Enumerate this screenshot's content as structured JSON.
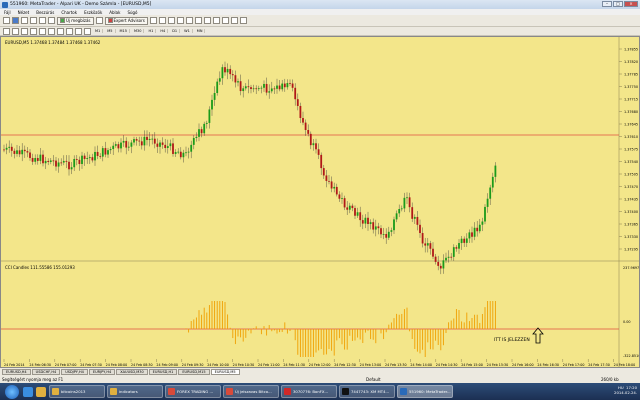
{
  "window": {
    "title": "551960: MetaTrader - Alpari UK - Demo Számla - [EURUSD,M5]"
  },
  "menu": [
    "Fájl",
    "Nézet",
    "Beszúrás",
    "Chartok",
    "Eszközök",
    "Ablak",
    "Súgó"
  ],
  "toolbar": {
    "new_order": "Új megbízás",
    "expert_advisors": "Expert Advisors",
    "timeframes": [
      "M1",
      "M5",
      "M15",
      "M30",
      "H1",
      "H4",
      "D1",
      "W1",
      "MN"
    ]
  },
  "chart": {
    "header": "EURUSD,M5  1.37468 1.37484 1.37468 1.37462",
    "indicator_header": "CCI Candles 111.55586 155.01293",
    "annotation": "ITT IS JELEZZEN",
    "price_labels": [
      "1.37855",
      "1.37820",
      "1.37785",
      "1.37750",
      "1.37715",
      "1.37680",
      "1.37645",
      "1.37610",
      "1.37575",
      "1.37540",
      "1.37505",
      "1.37470",
      "1.37435",
      "1.37400",
      "1.37365",
      "1.37330",
      "1.37295"
    ],
    "cci_labels": [
      "237.9697",
      "0.00",
      "-322.8510"
    ],
    "time_labels": [
      "24 Feb 2014",
      "24 Feb 06:30",
      "24 Feb 07:00",
      "24 Feb 07:30",
      "24 Feb 08:00",
      "24 Feb 08:30",
      "24 Feb 09:00",
      "24 Feb 09:30",
      "24 Feb 10:00",
      "24 Feb 10:30",
      "24 Feb 11:00",
      "24 Feb 11:30",
      "24 Feb 12:00",
      "24 Feb 12:30",
      "24 Feb 13:00",
      "24 Feb 13:30",
      "24 Feb 14:00",
      "24 Feb 14:30",
      "24 Feb 15:00",
      "24 Feb 15:30",
      "24 Feb 16:00",
      "24 Feb 16:30",
      "24 Feb 17:00",
      "24 Feb 17:30",
      "24 Feb 18:00"
    ],
    "colors": {
      "bg": "#f3e68a",
      "bull": "#1a9a1a",
      "bear": "#b01818",
      "cci": "#f0a000",
      "level": "#e05040"
    }
  },
  "symbol_tabs": [
    "EURUSD,H4",
    "USDCHF,H4",
    "USDJPY,H4",
    "EURJPY,H4",
    "XAUUSD,M30",
    "EURUSD,H1",
    "EURUSD,M15",
    "EURUSD,M5"
  ],
  "status": {
    "help": "Segítségért nyomja meg az F1",
    "profile": "Default",
    "traffic": "260/0 kb"
  },
  "taskbar": {
    "items": [
      "bitcoins2013",
      "indicators",
      "FOREX TRADING ...",
      "Új jelszavas Bitco...",
      "3070776: BonFX...",
      "7447743: XM MT4...",
      "551960: MetaTrader..."
    ],
    "lang": "HU",
    "time": "17:20",
    "date": "2014.02.24."
  }
}
